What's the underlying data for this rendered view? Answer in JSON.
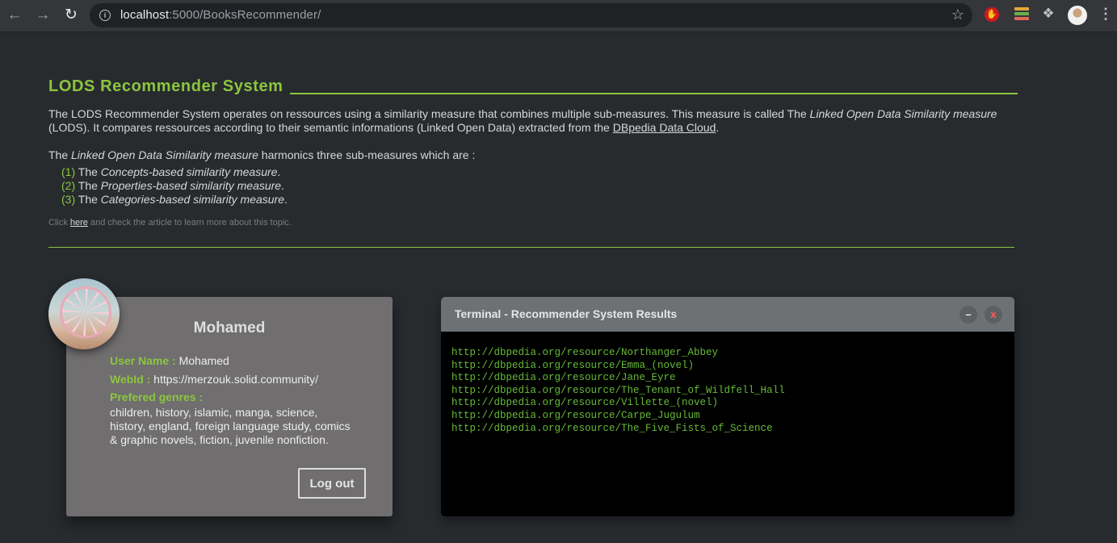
{
  "browser": {
    "url_host": "localhost",
    "url_path": ":5000/BooksRecommender/"
  },
  "page": {
    "title": "LODS Recommender System",
    "intro_1": "The LODS Recommender System operates on ressources using a similarity measure that combines multiple sub-measures. This measure is called The ",
    "intro_em": "Linked Open Data Similarity measure",
    "intro_2": " (LODS). It compares ressources according to their semantic informations (Linked Open Data) extracted from the ",
    "intro_link": "DBpedia Data Cloud",
    "intro_3": ".",
    "harm_1": "The ",
    "harm_em": "Linked Open Data Similarity measure",
    "harm_2": " harmonics three sub-measures which are :",
    "measures": [
      {
        "num": "(1)",
        "pre": " The ",
        "name": "Concepts-based similarity measure",
        "post": "."
      },
      {
        "num": "(2)",
        "pre": " The ",
        "name": "Properties-based similarity measure",
        "post": "."
      },
      {
        "num": "(3)",
        "pre": " The ",
        "name": "Categories-based similarity measure",
        "post": "."
      }
    ],
    "note_pre": "Click ",
    "note_link": "here",
    "note_post": " and check the article to learn more about this topic."
  },
  "profile": {
    "name": "Mohamed",
    "username_label": "User Name :",
    "username": " Mohamed",
    "webid_label": "WebId :",
    "webid": " https://merzouk.solid.community/",
    "genres_label": "Prefered genres :",
    "genres": "children, history, islamic, manga, science, history, england, foreign language study, comics & graphic novels, fiction, juvenile nonfiction.",
    "logout": "Log out"
  },
  "terminal": {
    "title": "Terminal - Recommender System Results",
    "minimize": "–",
    "close": "x",
    "lines": [
      "http://dbpedia.org/resource/Northanger_Abbey",
      "http://dbpedia.org/resource/Emma_(novel)",
      "http://dbpedia.org/resource/Jane_Eyre",
      "http://dbpedia.org/resource/The_Tenant_of_Wildfell_Hall",
      "http://dbpedia.org/resource/Villette_(novel)",
      "http://dbpedia.org/resource/Carpe_Jugulum",
      "http://dbpedia.org/resource/The_Five_Fists_of_Science"
    ]
  },
  "colors": {
    "accent": "#8cc63f",
    "background": "#272b2e",
    "card": "#706e6f",
    "terminal_text": "#66bb38"
  },
  "icons": [
    "back-icon",
    "forward-icon",
    "reload-icon",
    "info-icon",
    "star-icon",
    "adblock-icon",
    "extension-stack-icon",
    "puzzle-icon",
    "profile-icon",
    "menu-icon"
  ]
}
